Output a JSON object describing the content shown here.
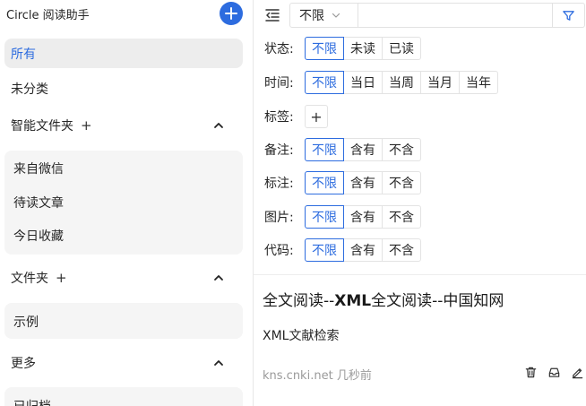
{
  "sidebar": {
    "app_title": "Circle 阅读助手",
    "nav": [
      {
        "label": "所有"
      },
      {
        "label": "未分类"
      }
    ],
    "smart_folders": {
      "title": "智能文件夹",
      "items": [
        "来自微信",
        "待读文章",
        "今日收藏"
      ]
    },
    "folders": {
      "title": "文件夹",
      "items": [
        "示例"
      ]
    },
    "more": {
      "title": "更多",
      "items": [
        "已归档"
      ]
    },
    "section_plus": "+"
  },
  "toolbar": {
    "scope": "不限",
    "search_value": ""
  },
  "filters": {
    "status": {
      "label": "状态:",
      "options": [
        "不限",
        "未读",
        "已读"
      ]
    },
    "time": {
      "label": "时间:",
      "options": [
        "不限",
        "当日",
        "当周",
        "当月",
        "当年"
      ]
    },
    "tags": {
      "label": "标签:",
      "add": "+"
    },
    "notes": {
      "label": "备注:",
      "options": [
        "不限",
        "含有",
        "不含"
      ]
    },
    "highlights": {
      "label": "标注:",
      "options": [
        "不限",
        "含有",
        "不含"
      ]
    },
    "images": {
      "label": "图片:",
      "options": [
        "不限",
        "含有",
        "不含"
      ]
    },
    "code": {
      "label": "代码:",
      "options": [
        "不限",
        "含有",
        "不含"
      ]
    }
  },
  "article": {
    "title_part1": "全文阅读--",
    "title_bold": "XML",
    "title_part2": "全文阅读--中国知网",
    "subtitle": "XML文献检索",
    "source": "kns.cnki.net",
    "time": "几秒前"
  },
  "colors": {
    "accent": "#2d6cdf",
    "active_bg": "#ededed",
    "group_bg": "#f5f5f5"
  }
}
